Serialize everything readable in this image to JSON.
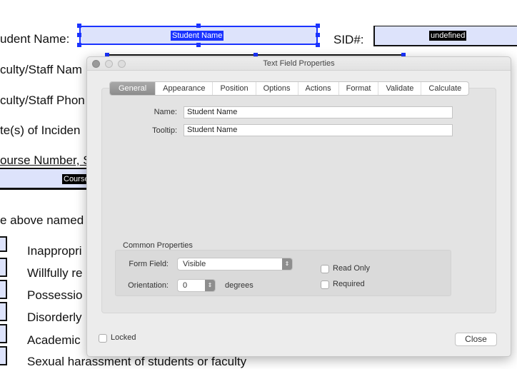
{
  "form": {
    "student_name_label": "udent Name:",
    "student_name_field": "Student Name",
    "sid_label": "SID#:",
    "sid_field": "undefined",
    "rows": [
      "culty/Staff Nam",
      "culty/Staff Phon",
      "te(s) of Inciden",
      "ourse Number, S"
    ],
    "course_field": "Course",
    "above_named": "e above named",
    "items": [
      "Inappropri",
      "Willfully re",
      "Possessio",
      "Disorderly",
      "Academic",
      "Sexual harassment of students or faculty"
    ]
  },
  "dialog": {
    "title": "Text Field Properties",
    "tabs": [
      "General",
      "Appearance",
      "Position",
      "Options",
      "Actions",
      "Format",
      "Validate",
      "Calculate"
    ],
    "active_tab": "General",
    "name_label": "Name:",
    "name_value": "Student Name",
    "tooltip_label": "Tooltip:",
    "tooltip_value": "Student Name",
    "common_properties": "Common Properties",
    "form_field_label": "Form Field:",
    "form_field_value": "Visible",
    "orientation_label": "Orientation:",
    "orientation_value": "0",
    "degrees": "degrees",
    "read_only": "Read Only",
    "read_only_checked": false,
    "required": "Required",
    "required_checked": false,
    "locked": "Locked",
    "locked_checked": false,
    "close": "Close"
  },
  "colors": {
    "field_bg": "#dde3fb",
    "selection": "#1a33ff"
  }
}
